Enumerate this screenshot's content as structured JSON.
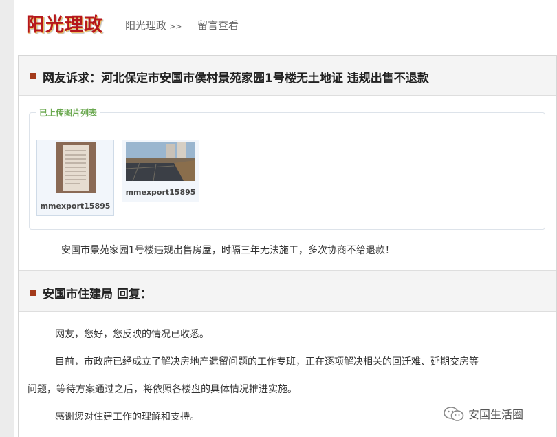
{
  "header": {
    "logo_text": "阳光理政",
    "breadcrumb_label": "阳光理政",
    "breadcrumb_sep": ">>",
    "nav_link": "留言查看"
  },
  "complaint": {
    "title": "网友诉求：河北保定市安国市侯村景苑家园1号楼无土地证 违规出售不退款",
    "images_legend": "已上传图片列表",
    "images": [
      {
        "caption": "mmexport15895"
      },
      {
        "caption": "mmexport15895"
      }
    ],
    "body": "安国市景苑家园1号楼违规出售房屋，时隔三年无法施工，多次协商不给退款！"
  },
  "reply": {
    "title": "安国市住建局 回复：",
    "paragraphs": [
      "网友，您好，您反映的情况已收悉。",
      "目前，市政府已经成立了解决房地产遗留问题的工作专班，正在逐项解决相关的回迁难、延期交房等",
      "问题，等待方案通过之后，将依照各楼盘的具体情况推进实施。",
      "感谢您对住建工作的理解和支持。"
    ]
  },
  "watermark": {
    "text": "安国生活圈",
    "icon": "wechat-icon"
  },
  "colors": {
    "logo": "#b5161c",
    "accent_square": "#a33a1a",
    "legend": "#6aa84f"
  }
}
